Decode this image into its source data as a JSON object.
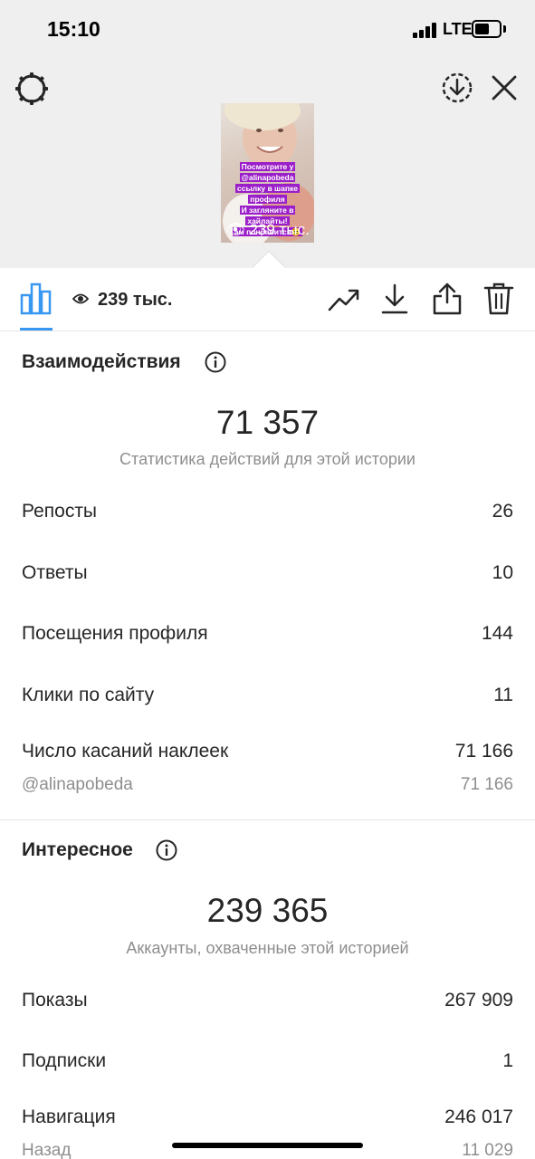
{
  "status_bar": {
    "time": "15:10",
    "network": "LTE"
  },
  "header": {
    "settings_icon": "gear-icon",
    "download_icon": "download-circle-icon",
    "close_icon": "close-icon",
    "story_text": [
      "Посмотрите у",
      "@alinapobeda",
      "ссылку в шапке",
      "профиля",
      "И загляните в",
      "хайлайты!",
      "ам понравится😉"
    ],
    "story_views": "239 тыс."
  },
  "toolbar": {
    "insights_icon": "bar-chart-icon",
    "views_icon": "eye-icon",
    "views": "239 тыс.",
    "actions": [
      "trending-icon",
      "download-icon",
      "share-icon",
      "trash-icon"
    ]
  },
  "interactions": {
    "title": "Взаимодействия",
    "total": "71 357",
    "caption": "Статистика действий для этой истории",
    "rows": [
      {
        "label": "Репосты",
        "value": "26"
      },
      {
        "label": "Ответы",
        "value": "10"
      },
      {
        "label": "Посещения профиля",
        "value": "144"
      },
      {
        "label": "Клики по сайту",
        "value": "11"
      },
      {
        "label": "Число касаний наклеек",
        "value": "71 166"
      }
    ],
    "sub_row": {
      "label": "@alinapobeda",
      "value": "71 166"
    }
  },
  "discovery": {
    "title": "Интересное",
    "total": "239 365",
    "caption": "Аккаунты, охваченные этой историей",
    "rows": [
      {
        "label": "Показы",
        "value": "267 909"
      },
      {
        "label": "Подписки",
        "value": "1"
      },
      {
        "label": "Навигация",
        "value": "246 017"
      }
    ],
    "sub_row": {
      "label": "Назад",
      "value": "11 029"
    }
  },
  "colors": {
    "accent": "#3897f0",
    "story_label": "#9b1fc9",
    "header_bg": "#efefef",
    "muted_text": "#8e8e8e"
  }
}
